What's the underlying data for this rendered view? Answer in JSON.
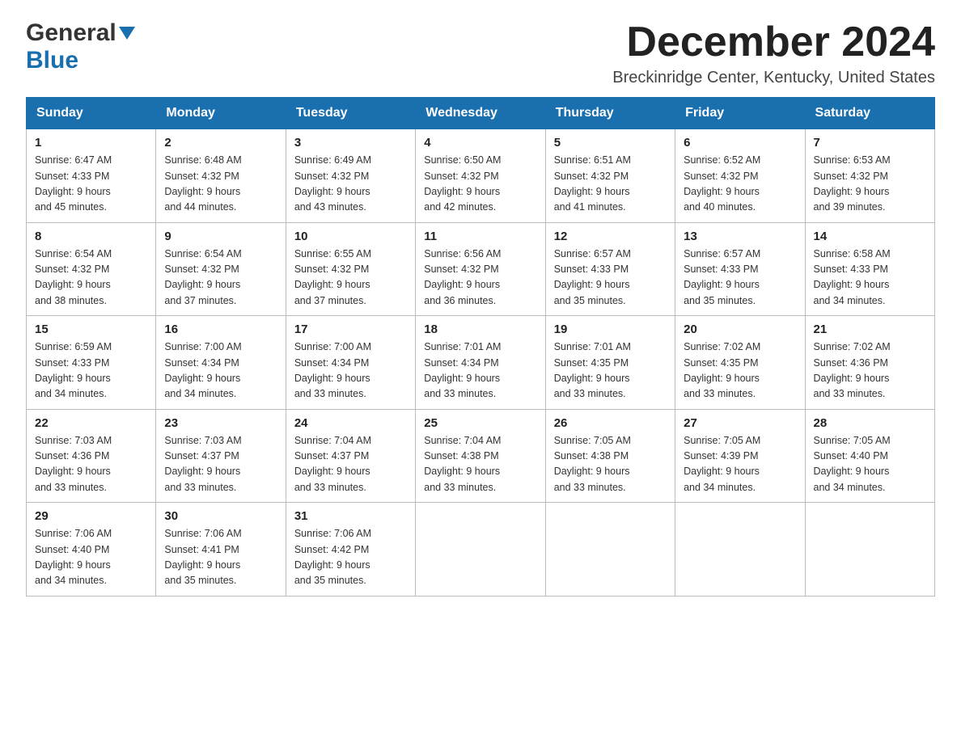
{
  "header": {
    "logo_general": "General",
    "logo_blue": "Blue",
    "month_title": "December 2024",
    "location": "Breckinridge Center, Kentucky, United States"
  },
  "days_of_week": [
    "Sunday",
    "Monday",
    "Tuesday",
    "Wednesday",
    "Thursday",
    "Friday",
    "Saturday"
  ],
  "weeks": [
    [
      {
        "day": "1",
        "sunrise": "6:47 AM",
        "sunset": "4:33 PM",
        "daylight": "9 hours and 45 minutes."
      },
      {
        "day": "2",
        "sunrise": "6:48 AM",
        "sunset": "4:32 PM",
        "daylight": "9 hours and 44 minutes."
      },
      {
        "day": "3",
        "sunrise": "6:49 AM",
        "sunset": "4:32 PM",
        "daylight": "9 hours and 43 minutes."
      },
      {
        "day": "4",
        "sunrise": "6:50 AM",
        "sunset": "4:32 PM",
        "daylight": "9 hours and 42 minutes."
      },
      {
        "day": "5",
        "sunrise": "6:51 AM",
        "sunset": "4:32 PM",
        "daylight": "9 hours and 41 minutes."
      },
      {
        "day": "6",
        "sunrise": "6:52 AM",
        "sunset": "4:32 PM",
        "daylight": "9 hours and 40 minutes."
      },
      {
        "day": "7",
        "sunrise": "6:53 AM",
        "sunset": "4:32 PM",
        "daylight": "9 hours and 39 minutes."
      }
    ],
    [
      {
        "day": "8",
        "sunrise": "6:54 AM",
        "sunset": "4:32 PM",
        "daylight": "9 hours and 38 minutes."
      },
      {
        "day": "9",
        "sunrise": "6:54 AM",
        "sunset": "4:32 PM",
        "daylight": "9 hours and 37 minutes."
      },
      {
        "day": "10",
        "sunrise": "6:55 AM",
        "sunset": "4:32 PM",
        "daylight": "9 hours and 37 minutes."
      },
      {
        "day": "11",
        "sunrise": "6:56 AM",
        "sunset": "4:32 PM",
        "daylight": "9 hours and 36 minutes."
      },
      {
        "day": "12",
        "sunrise": "6:57 AM",
        "sunset": "4:33 PM",
        "daylight": "9 hours and 35 minutes."
      },
      {
        "day": "13",
        "sunrise": "6:57 AM",
        "sunset": "4:33 PM",
        "daylight": "9 hours and 35 minutes."
      },
      {
        "day": "14",
        "sunrise": "6:58 AM",
        "sunset": "4:33 PM",
        "daylight": "9 hours and 34 minutes."
      }
    ],
    [
      {
        "day": "15",
        "sunrise": "6:59 AM",
        "sunset": "4:33 PM",
        "daylight": "9 hours and 34 minutes."
      },
      {
        "day": "16",
        "sunrise": "7:00 AM",
        "sunset": "4:34 PM",
        "daylight": "9 hours and 34 minutes."
      },
      {
        "day": "17",
        "sunrise": "7:00 AM",
        "sunset": "4:34 PM",
        "daylight": "9 hours and 33 minutes."
      },
      {
        "day": "18",
        "sunrise": "7:01 AM",
        "sunset": "4:34 PM",
        "daylight": "9 hours and 33 minutes."
      },
      {
        "day": "19",
        "sunrise": "7:01 AM",
        "sunset": "4:35 PM",
        "daylight": "9 hours and 33 minutes."
      },
      {
        "day": "20",
        "sunrise": "7:02 AM",
        "sunset": "4:35 PM",
        "daylight": "9 hours and 33 minutes."
      },
      {
        "day": "21",
        "sunrise": "7:02 AM",
        "sunset": "4:36 PM",
        "daylight": "9 hours and 33 minutes."
      }
    ],
    [
      {
        "day": "22",
        "sunrise": "7:03 AM",
        "sunset": "4:36 PM",
        "daylight": "9 hours and 33 minutes."
      },
      {
        "day": "23",
        "sunrise": "7:03 AM",
        "sunset": "4:37 PM",
        "daylight": "9 hours and 33 minutes."
      },
      {
        "day": "24",
        "sunrise": "7:04 AM",
        "sunset": "4:37 PM",
        "daylight": "9 hours and 33 minutes."
      },
      {
        "day": "25",
        "sunrise": "7:04 AM",
        "sunset": "4:38 PM",
        "daylight": "9 hours and 33 minutes."
      },
      {
        "day": "26",
        "sunrise": "7:05 AM",
        "sunset": "4:38 PM",
        "daylight": "9 hours and 33 minutes."
      },
      {
        "day": "27",
        "sunrise": "7:05 AM",
        "sunset": "4:39 PM",
        "daylight": "9 hours and 34 minutes."
      },
      {
        "day": "28",
        "sunrise": "7:05 AM",
        "sunset": "4:40 PM",
        "daylight": "9 hours and 34 minutes."
      }
    ],
    [
      {
        "day": "29",
        "sunrise": "7:06 AM",
        "sunset": "4:40 PM",
        "daylight": "9 hours and 34 minutes."
      },
      {
        "day": "30",
        "sunrise": "7:06 AM",
        "sunset": "4:41 PM",
        "daylight": "9 hours and 35 minutes."
      },
      {
        "day": "31",
        "sunrise": "7:06 AM",
        "sunset": "4:42 PM",
        "daylight": "9 hours and 35 minutes."
      },
      null,
      null,
      null,
      null
    ]
  ],
  "labels": {
    "sunrise": "Sunrise:",
    "sunset": "Sunset:",
    "daylight": "Daylight:"
  }
}
